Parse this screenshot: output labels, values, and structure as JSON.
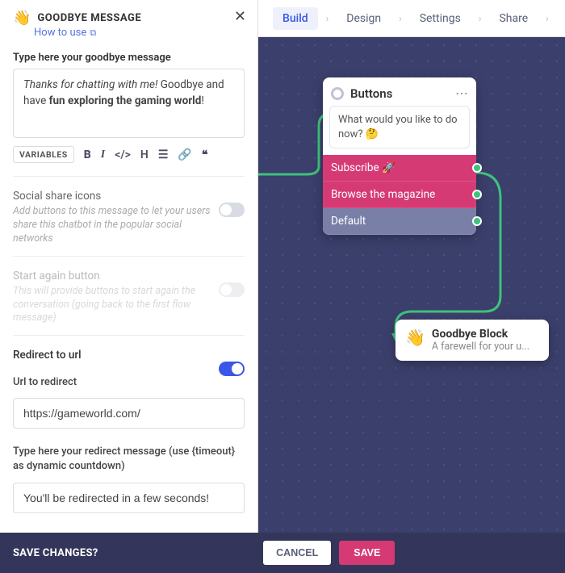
{
  "panel": {
    "icon": "👋",
    "title": "GOODBYE MESSAGE",
    "how_to_use": "How to use"
  },
  "editor": {
    "label": "Type here your goodbye message",
    "text_prefix_italic": "Thanks for chatting with me!",
    "text_mid": " Goodbye and have ",
    "text_bold": "fun exploring the gaming world",
    "text_suffix": "!"
  },
  "toolbar": {
    "variables": "VARIABLES"
  },
  "settings": {
    "social": {
      "title": "Social share icons",
      "desc": "Add buttons to this message to let your users share this chatbot in the popular social networks",
      "on": false
    },
    "start_again": {
      "title": "Start again button",
      "desc": "This will provide buttons to start again the conversation (going back to the first flow message)",
      "on": false
    },
    "redirect": {
      "title": "Redirect to url",
      "on": true,
      "url_label": "Url to redirect",
      "url_value": "https://gameworld.com/",
      "msg_label": "Type here your redirect message (use {timeout} as dynamic countdown)",
      "msg_value": "You'll be redirected in a few seconds!"
    }
  },
  "topnav": {
    "tabs": [
      "Build",
      "Design",
      "Settings",
      "Share"
    ],
    "active": "Build"
  },
  "canvas": {
    "buttons_node": {
      "title": "Buttons",
      "prompt": "What would you like to do now? 🤔",
      "options": [
        {
          "label": "Subscribe 🚀",
          "style": "sub"
        },
        {
          "label": "Browse the magazine",
          "style": "browse"
        },
        {
          "label": "Default",
          "style": "default"
        }
      ]
    },
    "goodbye_node": {
      "icon": "👋",
      "title": "Goodbye Block",
      "subtitle": "A farewell for your u..."
    }
  },
  "footer": {
    "label": "SAVE CHANGES?",
    "cancel": "CANCEL",
    "save": "SAVE"
  }
}
